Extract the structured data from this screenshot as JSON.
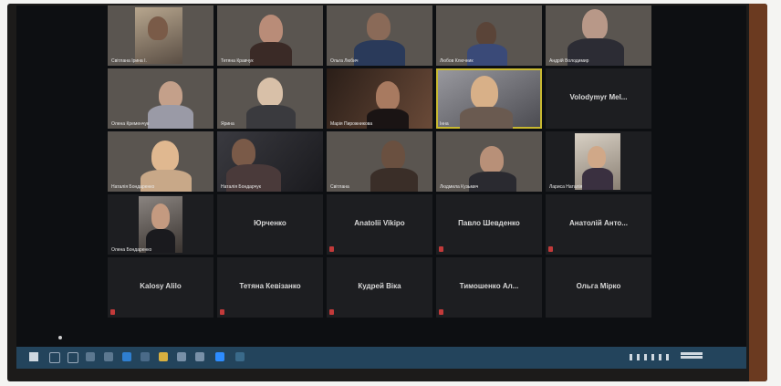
{
  "tiles_row1": [
    {
      "name": "Світлана Ірина І.",
      "type": "video"
    },
    {
      "name": "Тетяна Кравчук",
      "type": "video"
    },
    {
      "name": "Ольга Любич",
      "type": "video"
    },
    {
      "name": "Любов Ключник",
      "type": "video"
    },
    {
      "name": "Андрій Володимир",
      "type": "video"
    }
  ],
  "tiles_row2": [
    {
      "name": "Олена Кременчук",
      "type": "video"
    },
    {
      "name": "Ярина",
      "type": "video"
    },
    {
      "name": "Марія Пирожникова",
      "type": "video"
    },
    {
      "name": "Інна",
      "type": "video",
      "active": true
    },
    {
      "name": "Volodymyr Mel...",
      "type": "blank"
    }
  ],
  "tiles_row3": [
    {
      "name": "Наталія Бондаренко",
      "type": "video"
    },
    {
      "name": "Наталія Бондарчук",
      "type": "video"
    },
    {
      "name": "Світлана",
      "type": "video"
    },
    {
      "name": "Людмила Кузьмич",
      "type": "video"
    },
    {
      "name": "Лариса Наталія",
      "type": "video"
    }
  ],
  "tiles_row4": [
    {
      "name": "Олена Бондаренко",
      "type": "video"
    },
    {
      "name": "Юрченко",
      "type": "blank"
    },
    {
      "name": "Anatolii Vikipo",
      "type": "blank"
    },
    {
      "name": "Павло Шевденко",
      "type": "blank"
    },
    {
      "name": "Анатолій Анто...",
      "type": "blank"
    }
  ],
  "tiles_row5": [
    {
      "name": "Kalosy Alilo",
      "type": "blank"
    },
    {
      "name": "Тетяна Кевізанко",
      "type": "blank"
    },
    {
      "name": "Кудрей Віка",
      "type": "blank"
    },
    {
      "name": "Тимошенко Ал...",
      "type": "blank"
    },
    {
      "name": "Ольга Мірко",
      "type": "blank"
    }
  ],
  "colors": {
    "active_border": "#c8b830",
    "taskbar": "#23445c",
    "muted": "#c23a3a"
  }
}
